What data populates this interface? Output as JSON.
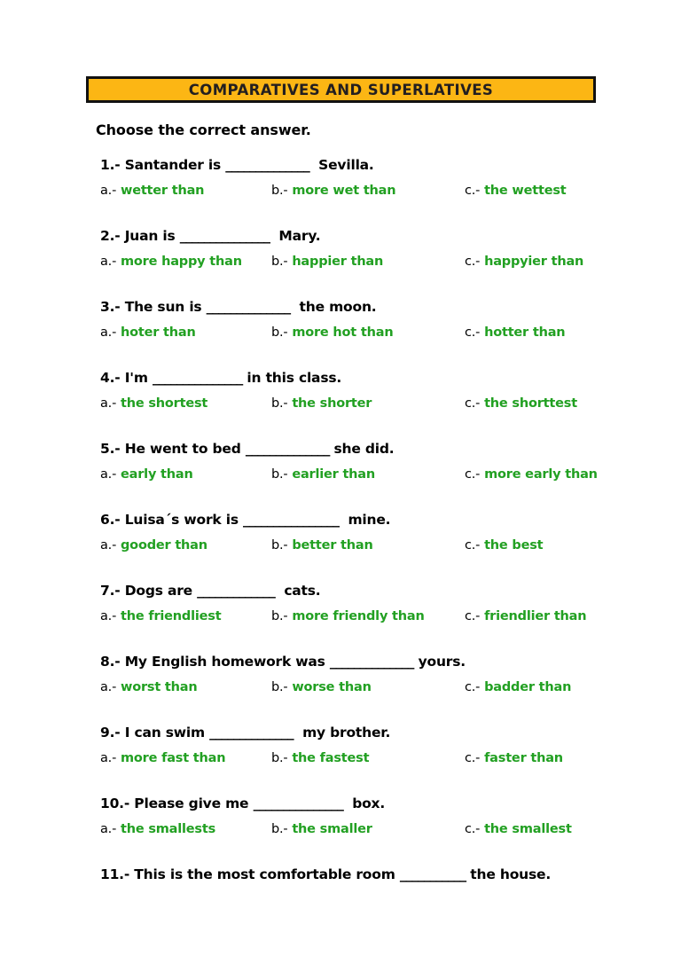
{
  "colors": {
    "title_background": "#fcb614",
    "title_border": "#111111",
    "title_text": "#231f20",
    "question_text": "#000000",
    "option_marker": "#000000",
    "option_text": "#22a022",
    "page_background": "#ffffff"
  },
  "header": {
    "title": "COMPARATIVES AND SUPERLATIVES"
  },
  "instruction": "Choose the correct answer.",
  "markers": {
    "a": "a.-",
    "b": "b.-",
    "c": "c.-"
  },
  "questions": [
    {
      "number": "1.-",
      "prompt_before": " Santander is ",
      "blank": "______________",
      "prompt_after": "  Sevilla.",
      "options": [
        {
          "marker": "a.-",
          "text": "wetter than"
        },
        {
          "marker": "b.-",
          "text": "more wet than"
        },
        {
          "marker": "c.-",
          "text": "the wettest"
        }
      ]
    },
    {
      "number": "2.-",
      "prompt_before": " Juan is ",
      "blank": "_______________",
      "prompt_after": "  Mary.",
      "options": [
        {
          "marker": "a.-",
          "text": "more happy than"
        },
        {
          "marker": "b.-",
          "text": "happier than"
        },
        {
          "marker": "c.-",
          "text": "happyier than"
        }
      ]
    },
    {
      "number": "3.-",
      "prompt_before": " The sun is ",
      "blank": "______________",
      "prompt_after": "  the moon.",
      "options": [
        {
          "marker": "a.-",
          "text": "hoter than"
        },
        {
          "marker": "b.-",
          "text": "more hot than"
        },
        {
          "marker": "c.-",
          "text": "hotter than"
        }
      ]
    },
    {
      "number": "4.-",
      "prompt_before": " I'm ",
      "blank": "_______________",
      "prompt_after": " in this class.",
      "options": [
        {
          "marker": "a.-",
          "text": "the shortest"
        },
        {
          "marker": "b.-",
          "text": "the shorter"
        },
        {
          "marker": "c.-",
          "text": "the shorttest"
        }
      ]
    },
    {
      "number": "5.-",
      "prompt_before": " He went to bed ",
      "blank": "______________",
      "prompt_after": " she did.",
      "options": [
        {
          "marker": "a.-",
          "text": "early than"
        },
        {
          "marker": "b.-",
          "text": "earlier than"
        },
        {
          "marker": "c.-",
          "text": "more early than"
        }
      ]
    },
    {
      "number": "6.-",
      "prompt_before": " Luisa´s work is ",
      "blank": "________________",
      "prompt_after": "  mine.",
      "options": [
        {
          "marker": "a.-",
          "text": "gooder than"
        },
        {
          "marker": "b.-",
          "text": "better than"
        },
        {
          "marker": "c.-",
          "text": "the best"
        }
      ]
    },
    {
      "number": "7.-",
      "prompt_before": " Dogs are ",
      "blank": "_____________",
      "prompt_after": "  cats.",
      "options": [
        {
          "marker": "a.-",
          "text": "the friendliest"
        },
        {
          "marker": "b.-",
          "text": "more friendly than"
        },
        {
          "marker": "c.-",
          "text": "friendlier than"
        }
      ]
    },
    {
      "number": "8.-",
      "prompt_before": " My English homework was ",
      "blank": "______________",
      "prompt_after": " yours.",
      "options": [
        {
          "marker": "a.-",
          "text": "worst than"
        },
        {
          "marker": "b.-",
          "text": "worse than"
        },
        {
          "marker": "c.-",
          "text": "badder than"
        }
      ]
    },
    {
      "number": "9.-",
      "prompt_before": " I can swim ",
      "blank": "______________",
      "prompt_after": "  my brother.",
      "options": [
        {
          "marker": "a.-",
          "text": "more fast than"
        },
        {
          "marker": "b.-",
          "text": "the fastest"
        },
        {
          "marker": "c.-",
          "text": "faster than"
        }
      ]
    },
    {
      "number": "10.-",
      "prompt_before": " Please give me ",
      "blank": "_______________",
      "prompt_after": "  box.",
      "options": [
        {
          "marker": "a.-",
          "text": "the smallests"
        },
        {
          "marker": "b.-",
          "text": "the smaller"
        },
        {
          "marker": "c.-",
          "text": "the smallest"
        }
      ]
    },
    {
      "number": "11.-",
      "prompt_before": " This is the most comfortable room ",
      "blank": "___________",
      "prompt_after": " the house.",
      "options": []
    }
  ]
}
